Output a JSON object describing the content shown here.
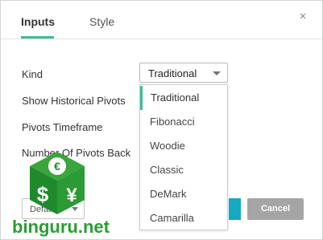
{
  "tabs": [
    {
      "label": "Inputs",
      "active": true
    },
    {
      "label": "Style",
      "active": false
    }
  ],
  "close_symbol": "×",
  "form": {
    "kind_label": "Kind",
    "show_historical_label": "Show Historical Pivots",
    "pivots_timeframe_label": "Pivots Timeframe",
    "number_of_pivots_label": "Number Of Pivots Back",
    "kind_value": "Traditional"
  },
  "dropdown": {
    "options": [
      "Traditional",
      "Fibonacci",
      "Woodie",
      "Classic",
      "DeMark",
      "Camarilla"
    ],
    "selected": "Traditional"
  },
  "buttons": {
    "defaults_label": "Defaults",
    "cancel_label": "Cancel"
  },
  "watermark": {
    "text": "binguru.net",
    "icons": [
      "euro-icon",
      "dollar-icon",
      "yen-icon"
    ]
  },
  "colors": {
    "accent": "#3cbc98",
    "ok_button": "#17a8c4",
    "cancel_button": "#a5a5a5",
    "watermark_green": "#2a9d34"
  }
}
